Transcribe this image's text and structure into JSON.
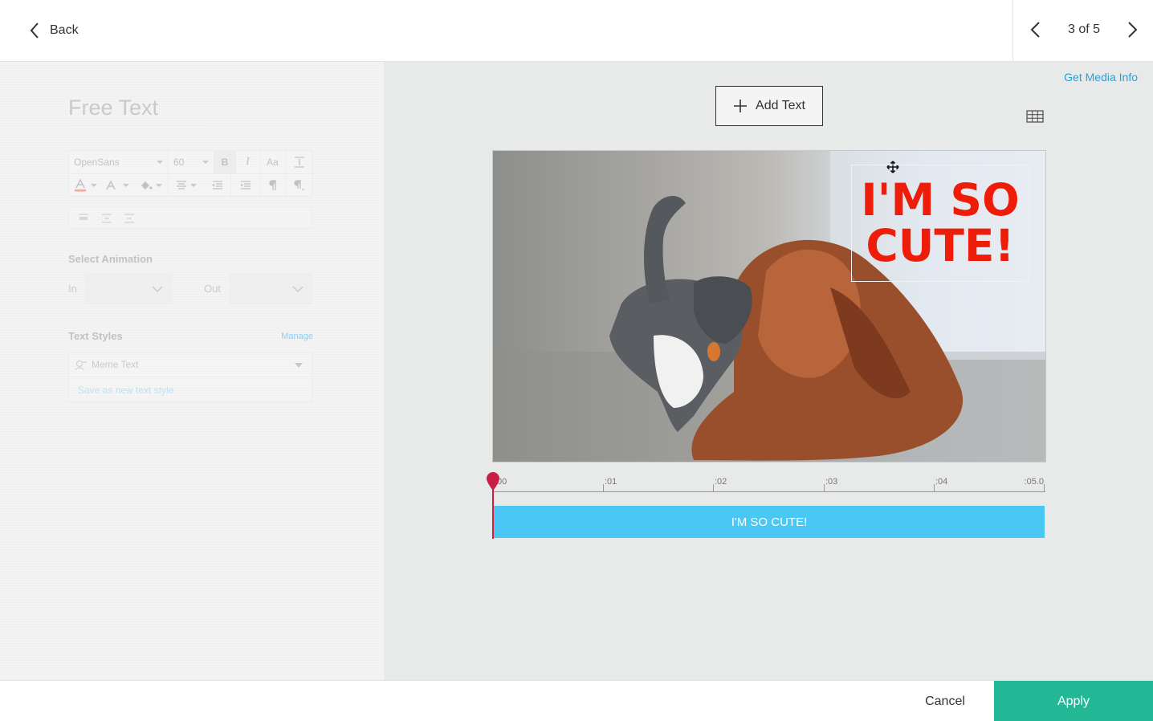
{
  "header": {
    "back_label": "Back",
    "pager_text": "3 of 5"
  },
  "editor": {
    "title": "Free Text",
    "font_family": "OpenSans",
    "font_size": "60",
    "bold_glyph": "B",
    "italic_glyph": "I",
    "case_glyph": "Aa",
    "select_animation_label": "Select Animation",
    "in_label": "In",
    "out_label": "Out",
    "text_styles_label": "Text Styles",
    "manage_label": "Manage",
    "style_selected": "Meme Text",
    "save_style_label": "Save as new text style"
  },
  "work": {
    "media_info_label": "Get Media Info",
    "add_text_label": "Add Text",
    "meme_text": "I'M SO CUTE!",
    "meme_color": "#ee1d0a"
  },
  "timeline": {
    "ticks": [
      ":00",
      ":01",
      ":02",
      ":03",
      ":04",
      ":05.0"
    ],
    "clip_label": "I'M SO CUTE!",
    "clip_color": "#4ac7f2",
    "playhead_color": "#c81f46"
  },
  "footer": {
    "cancel_label": "Cancel",
    "apply_label": "Apply",
    "apply_color": "#22b896"
  },
  "icons": {
    "back": "chevron-left-icon",
    "prev": "chevron-left-icon",
    "next": "chevron-right-icon",
    "add": "plus-icon",
    "grid": "grid-icon",
    "move": "move-icon"
  }
}
